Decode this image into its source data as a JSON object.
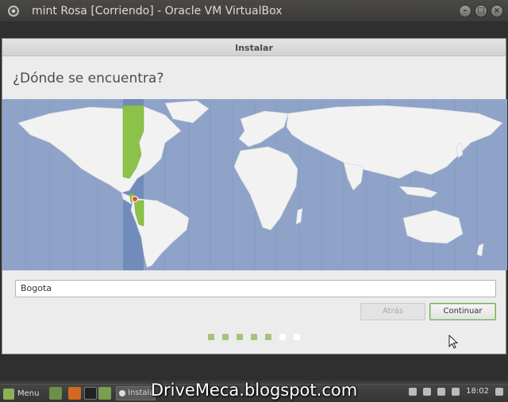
{
  "host_window": {
    "title": "mint Rosa [Corriendo] - Oracle VM VirtualBox",
    "icon": "virtualbox-icon",
    "buttons": [
      "minimize-icon",
      "maximize-icon",
      "close-icon"
    ]
  },
  "installer": {
    "window_title": "Instalar",
    "question": "¿Dónde se encuentra?",
    "location_input_value": "Bogota",
    "back_label": "Atrás",
    "continue_label": "Continuar",
    "selected_marker_color": "#e64a3b",
    "timezone_highlight_color": "#8bc34a",
    "map_ocean_color": "#8fa3c8",
    "land_color": "#f2f2f2"
  },
  "progress": {
    "steps_total": 7,
    "steps_completed": 5,
    "active_color": "#a3c47a",
    "inactive_color": "#ffffff"
  },
  "taskbar": {
    "menu_label": "Menu",
    "task_label": "Instalar",
    "clock": "18:02"
  },
  "watermark": "DriveMeca.blogspot.com"
}
